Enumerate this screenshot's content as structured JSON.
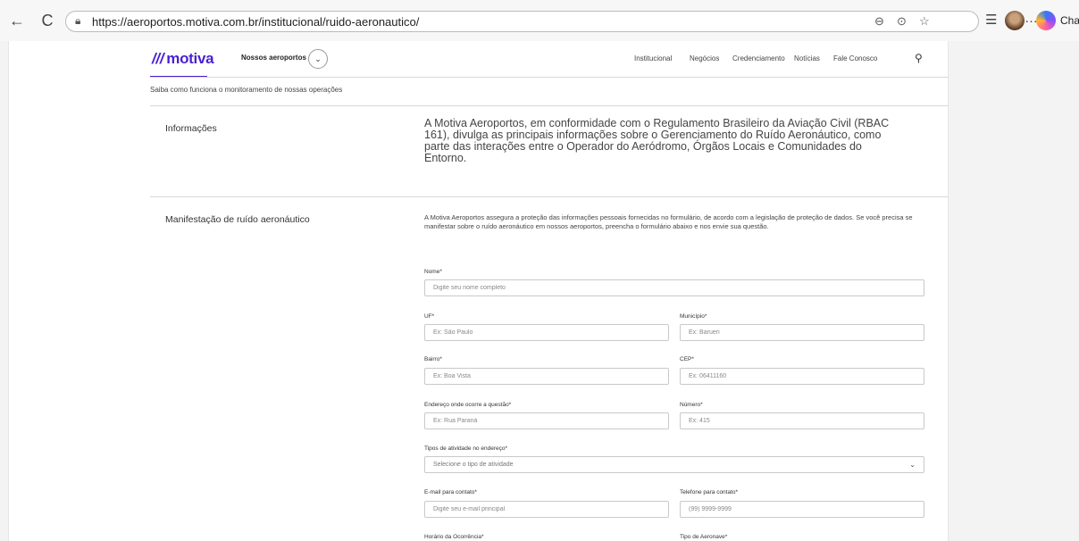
{
  "browser": {
    "back_icon": "←",
    "reload_icon": "C",
    "url": "https://aeroportos.motiva.com.br/institucional/ruido-aeronautico/",
    "chat_label": "Chat"
  },
  "header": {
    "logo_text": "motiva",
    "airports_link": "Nossos aeroportos",
    "menu": [
      "Institucional",
      "Negócios",
      "Credenciamento",
      "Notícias",
      "Fale Conosco"
    ]
  },
  "subtitle": "Saiba como funciona o monitoramento de nossas operações",
  "info": {
    "title": "Informações",
    "text": "A Motiva Aeroportos, em conformidade com o Regulamento Brasileiro da Aviação Civil (RBAC 161), divulga as principais informações sobre o Gerenciamento do Ruído Aeronáutico, como parte das interações entre o Operador do Aeródromo, Órgãos Locais e Comunidades do Entorno."
  },
  "form_section": {
    "title": "Manifestação de ruído aeronáutico",
    "intro": "A Motiva Aeroportos assegura a proteção das informações pessoais fornecidas no formulário, de acordo com a legislação de proteção de dados.  Se você precisa se manifestar sobre o ruído aeronáutico em nossos aeroportos, preencha o formulário abaixo e nos envie sua questão.",
    "fields": {
      "nome": {
        "label": "Nome*",
        "placeholder": "Digite seu nome completo"
      },
      "uf": {
        "label": "UF*",
        "placeholder": "Ex: São Paulo"
      },
      "municipio": {
        "label": "Município*",
        "placeholder": "Ex: Barueri"
      },
      "bairro": {
        "label": "Bairro*",
        "placeholder": "Ex: Boa Vista"
      },
      "cep": {
        "label": "CEP*",
        "placeholder": "Ex: 06411160"
      },
      "endereco": {
        "label": "Endereço onde ocorre a questão*",
        "placeholder": "Ex: Rua Paraná"
      },
      "numero": {
        "label": "Número*",
        "placeholder": "Ex: 415"
      },
      "atividade": {
        "label": "Tipos de atividade no endereço*",
        "placeholder": "Selecione o tipo de atividade"
      },
      "email": {
        "label": "E-mail para contato*",
        "placeholder": "Digite seu e-mail principal"
      },
      "telefone": {
        "label": "Telefone para contato*",
        "placeholder": "(99) 9999-9999"
      },
      "horario": {
        "label": "Horário da Ocorrência*"
      },
      "aeronave": {
        "label": "Tipo de Aeronave*"
      }
    }
  }
}
